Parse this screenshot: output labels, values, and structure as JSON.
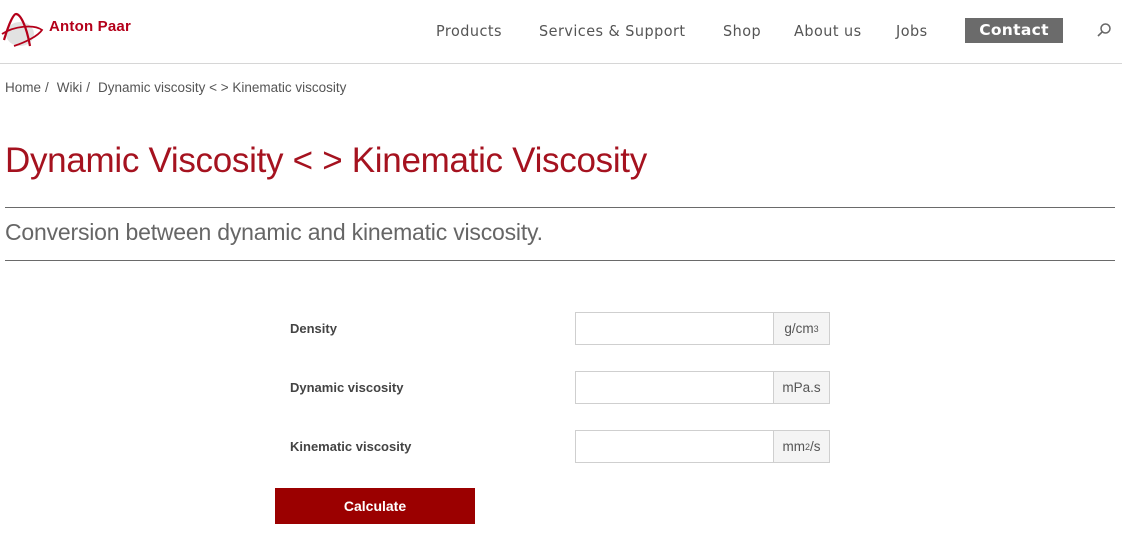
{
  "brand": {
    "name": "Anton Paar",
    "color": "#b4001a"
  },
  "nav": {
    "items": [
      {
        "label": "Products"
      },
      {
        "label": "Services & Support"
      },
      {
        "label": "Shop"
      },
      {
        "label": "About us"
      },
      {
        "label": "Jobs"
      }
    ],
    "contact_label": "Contact",
    "search_icon": "search-icon"
  },
  "breadcrumb": {
    "items": [
      {
        "label": "Home"
      },
      {
        "label": "Wiki"
      },
      {
        "label": "Dynamic viscosity < > Kinematic viscosity"
      }
    ],
    "separator": "/"
  },
  "page": {
    "title": "Dynamic Viscosity < > Kinematic Viscosity",
    "subtitle": "Conversion between dynamic and kinematic viscosity.",
    "title_color": "#a5121f"
  },
  "form": {
    "fields": [
      {
        "label": "Density",
        "value": "",
        "unit_base": "g/cm",
        "unit_sup": "3",
        "unit_tail": ""
      },
      {
        "label": "Dynamic viscosity",
        "value": "",
        "unit_base": "mPa.s",
        "unit_sup": "",
        "unit_tail": ""
      },
      {
        "label": "Kinematic viscosity",
        "value": "",
        "unit_base": "mm",
        "unit_sup": "2",
        "unit_tail": "/s"
      }
    ],
    "submit_label": "Calculate",
    "submit_color": "#9b0000"
  }
}
